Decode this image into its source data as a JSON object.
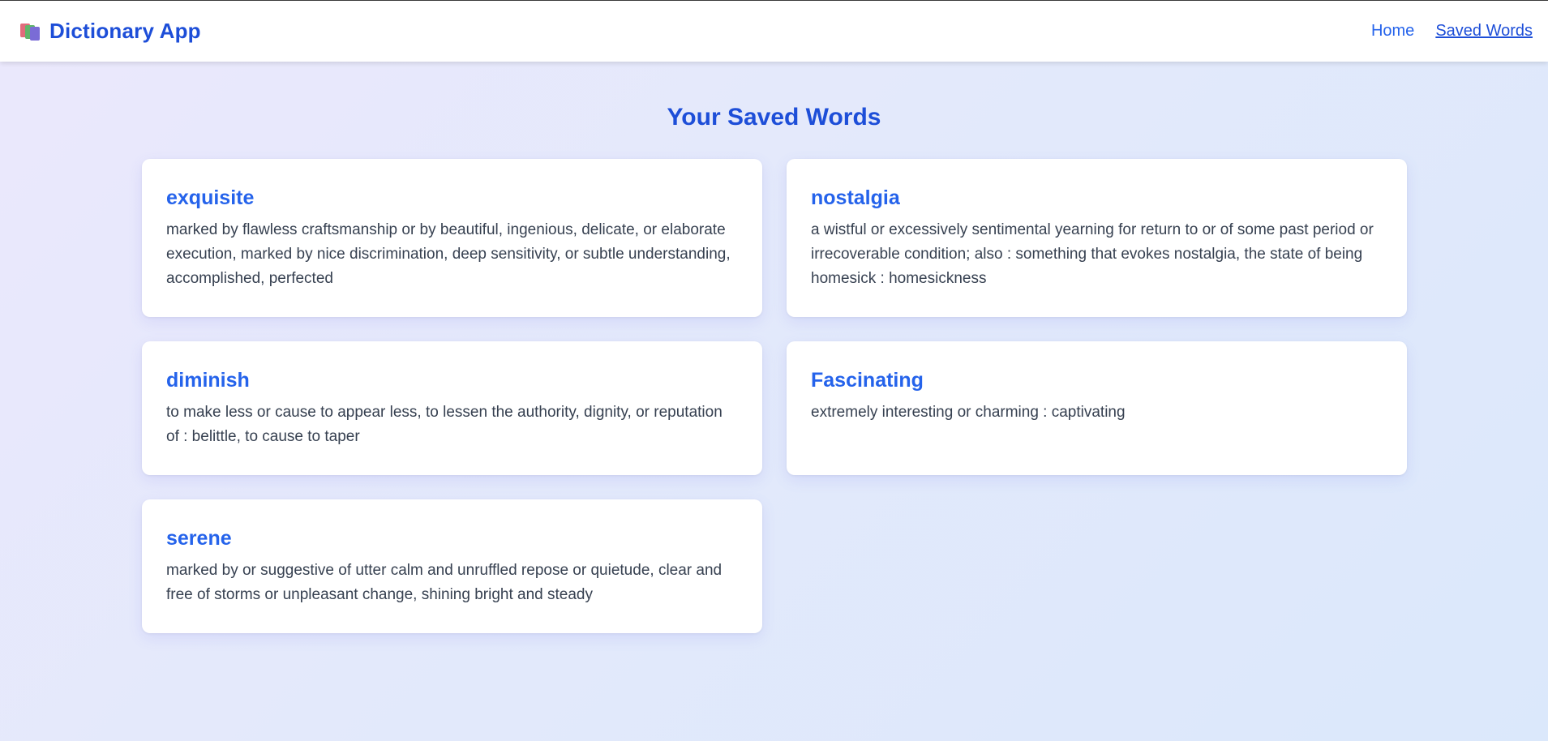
{
  "app": {
    "title": "Dictionary App",
    "icon": "books-icon"
  },
  "nav": {
    "home": "Home",
    "saved": "Saved Words"
  },
  "page": {
    "title": "Your Saved Words"
  },
  "words": [
    {
      "word": "exquisite",
      "definition": "marked by flawless craftsmanship or by beautiful, ingenious, delicate, or elaborate execution, marked by nice discrimination, deep sensitivity, or subtle understanding, accomplished, perfected"
    },
    {
      "word": "nostalgia",
      "definition": "a wistful or excessively sentimental yearning for return to or of some past period or irrecoverable condition; also : something that evokes nostalgia, the state of being homesick : homesickness"
    },
    {
      "word": "diminish",
      "definition": "to make less or cause to appear less, to lessen the authority, dignity, or reputation of : belittle, to cause to taper"
    },
    {
      "word": "Fascinating",
      "definition": "extremely interesting or charming : captivating"
    },
    {
      "word": "serene",
      "definition": "marked by or suggestive of utter calm and unruffled repose or quietude, clear and free of storms or unpleasant change, shining bright and steady"
    }
  ],
  "colors": {
    "accent": "#1d4ed8",
    "link": "#2563eb",
    "text": "#374151",
    "card": "#ffffff"
  }
}
